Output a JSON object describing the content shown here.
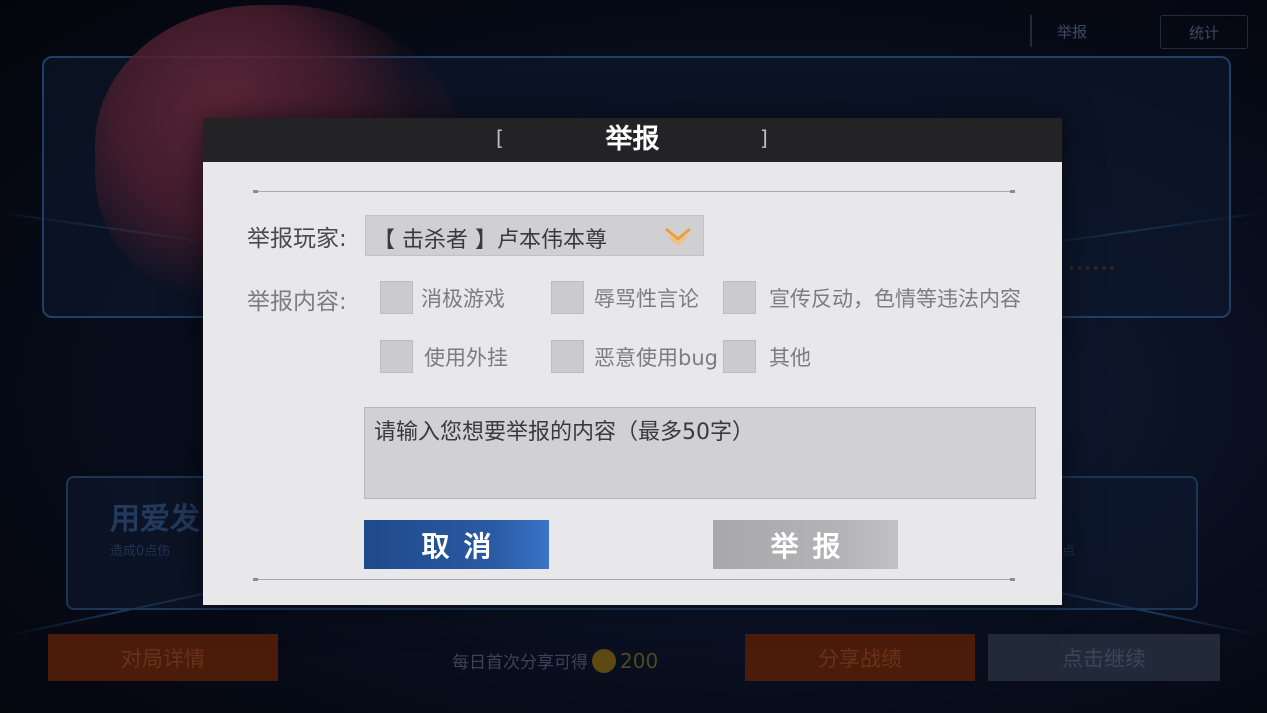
{
  "background": {
    "top_buttons": {
      "report": "举报",
      "stats": "统计"
    },
    "mid_panel": {
      "title": "用爱发",
      "subtitle": "造成0点伤",
      "right_text": "点"
    },
    "dots": "••••••",
    "bottom": {
      "detail_button": "对局详情",
      "share_tip": "每日首次分享可得",
      "share_amount": "200",
      "share_button": "分享战绩",
      "continue_button": "点击继续"
    }
  },
  "modal": {
    "title": "举报",
    "bracket_left": "[",
    "bracket_right": "]",
    "player_label": "举报玩家:",
    "player_value": "【 击杀者 】卢本伟本尊",
    "content_label": "举报内容:",
    "reasons": [
      {
        "label": "消极游戏",
        "checked": false
      },
      {
        "label": "辱骂性言论",
        "checked": false
      },
      {
        "label": "宣传反动，色情等违法内容",
        "checked": false
      },
      {
        "label": "使用外挂",
        "checked": false
      },
      {
        "label": "恶意使用bug",
        "checked": false
      },
      {
        "label": "其他",
        "checked": false
      }
    ],
    "textarea_placeholder": "请输入您想要举报的内容（最多50字）",
    "cancel_label": "取消",
    "submit_label": "举报"
  },
  "colors": {
    "header_bg": "#232325",
    "cancel_button": "#2a5aa4",
    "submit_button": "#b4b4b6",
    "select_chevron": "#f0a030"
  },
  "icons": [
    "chevron-down-icon",
    "coin-icon"
  ]
}
